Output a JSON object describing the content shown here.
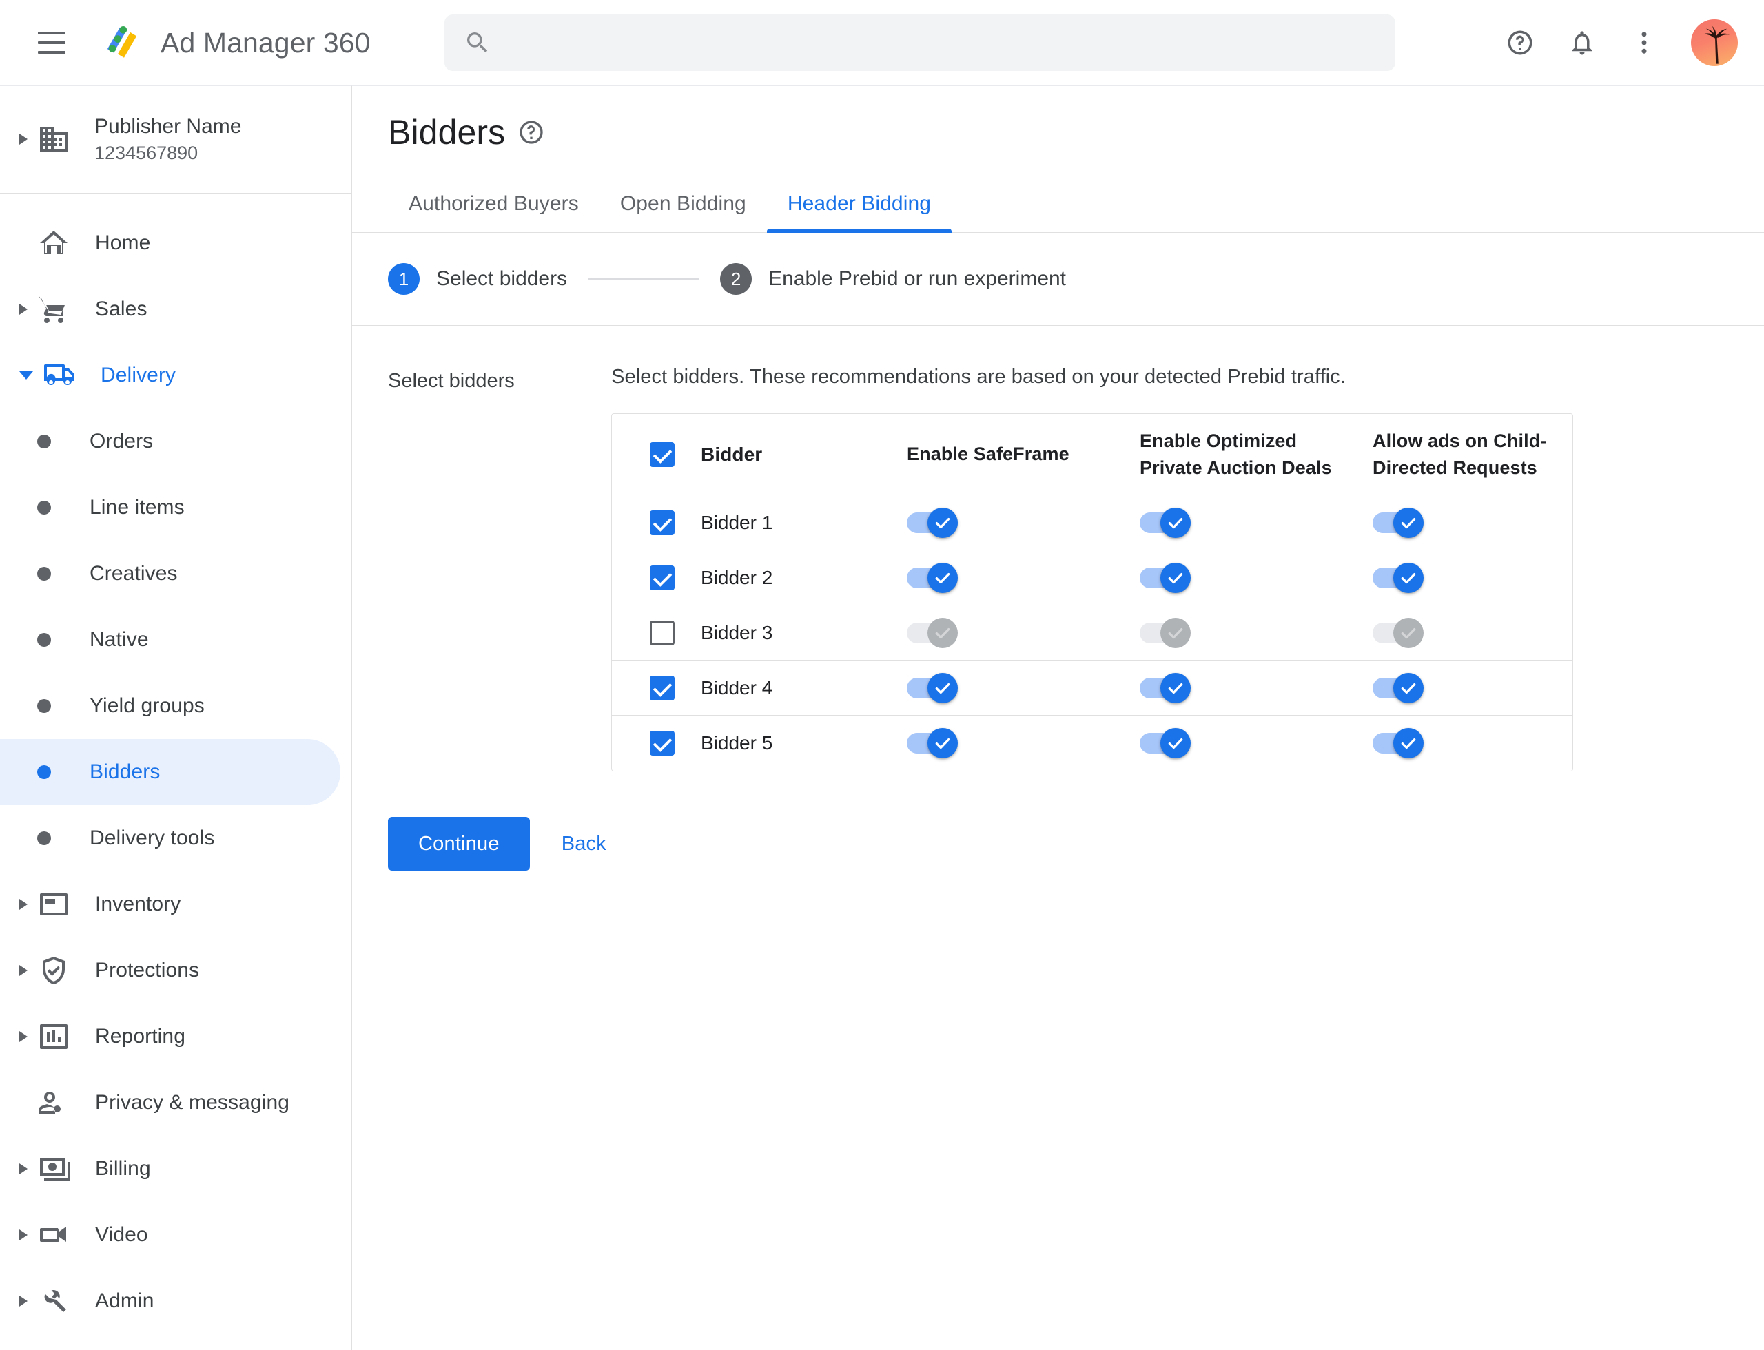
{
  "topbar": {
    "menu_icon": "hamburger-menu-icon",
    "brand_title": "Ad Manager 360",
    "search": {
      "value": "",
      "placeholder": ""
    },
    "help_icon": "help-circle-icon",
    "notifications_icon": "bell-icon",
    "more_icon": "more-vertical-icon",
    "avatar_icon": "user-avatar"
  },
  "sidebar": {
    "publisher": {
      "name": "Publisher Name",
      "id": "1234567890"
    },
    "items": [
      {
        "label": "Home",
        "icon": "home-icon",
        "expandable": false,
        "type": "top"
      },
      {
        "label": "Sales",
        "icon": "cart-icon",
        "expandable": true,
        "type": "top"
      },
      {
        "label": "Delivery",
        "icon": "truck-icon",
        "expandable": true,
        "type": "top",
        "expanded": true,
        "active": true
      },
      {
        "label": "Orders",
        "type": "sub"
      },
      {
        "label": "Line items",
        "type": "sub"
      },
      {
        "label": "Creatives",
        "type": "sub"
      },
      {
        "label": "Native",
        "type": "sub"
      },
      {
        "label": "Yield groups",
        "type": "sub"
      },
      {
        "label": "Bidders",
        "type": "sub",
        "selected": true
      },
      {
        "label": "Delivery tools",
        "type": "sub"
      },
      {
        "label": "Inventory",
        "icon": "inventory-icon",
        "expandable": true,
        "type": "top"
      },
      {
        "label": "Protections",
        "icon": "shield-check-icon",
        "expandable": true,
        "type": "top"
      },
      {
        "label": "Reporting",
        "icon": "bar-chart-icon",
        "expandable": true,
        "type": "top"
      },
      {
        "label": "Privacy & messaging",
        "icon": "person-privacy-icon",
        "expandable": false,
        "type": "top"
      },
      {
        "label": "Billing",
        "icon": "money-icon",
        "expandable": true,
        "type": "top"
      },
      {
        "label": "Video",
        "icon": "video-camera-icon",
        "expandable": true,
        "type": "top"
      },
      {
        "label": "Admin",
        "icon": "wrench-icon",
        "expandable": true,
        "type": "top"
      }
    ]
  },
  "page": {
    "title": "Bidders",
    "help_icon": "help-circle-icon",
    "tabs": [
      {
        "label": "Authorized Buyers",
        "active": false
      },
      {
        "label": "Open Bidding",
        "active": false
      },
      {
        "label": "Header Bidding",
        "active": true
      }
    ],
    "stepper": [
      {
        "number": "1",
        "label": "Select bidders",
        "state": "current"
      },
      {
        "number": "2",
        "label": "Enable Prebid or run experiment",
        "state": "upcoming"
      }
    ],
    "section_label": "Select bidders",
    "description": "Select bidders. These recommendations are based on your detected Prebid traffic."
  },
  "table": {
    "header_checkbox_checked": true,
    "columns": [
      "Bidder",
      "Enable SafeFrame",
      "Enable Optimized Private Auction Deals",
      "Allow ads on Child-Directed Requests"
    ],
    "rows": [
      {
        "name": "Bidder 1",
        "selected": true,
        "safeframe": true,
        "optimized_deals": true,
        "child_directed": true
      },
      {
        "name": "Bidder 2",
        "selected": true,
        "safeframe": true,
        "optimized_deals": true,
        "child_directed": true
      },
      {
        "name": "Bidder 3",
        "selected": false,
        "safeframe": false,
        "optimized_deals": false,
        "child_directed": false
      },
      {
        "name": "Bidder 4",
        "selected": true,
        "safeframe": true,
        "optimized_deals": true,
        "child_directed": true
      },
      {
        "name": "Bidder 5",
        "selected": true,
        "safeframe": true,
        "optimized_deals": true,
        "child_directed": true
      }
    ]
  },
  "actions": {
    "continue_label": "Continue",
    "back_label": "Back"
  },
  "colors": {
    "accent_blue": "#1a73e8",
    "toggle_track_on": "#a6c5f8",
    "toggle_track_off": "#e8eaed",
    "toggle_thumb_off": "#b0b3b6",
    "selected_nav_bg": "#e8f0fe",
    "text_primary": "#202124",
    "text_secondary": "#5f6368",
    "border": "#e0e0e0"
  }
}
